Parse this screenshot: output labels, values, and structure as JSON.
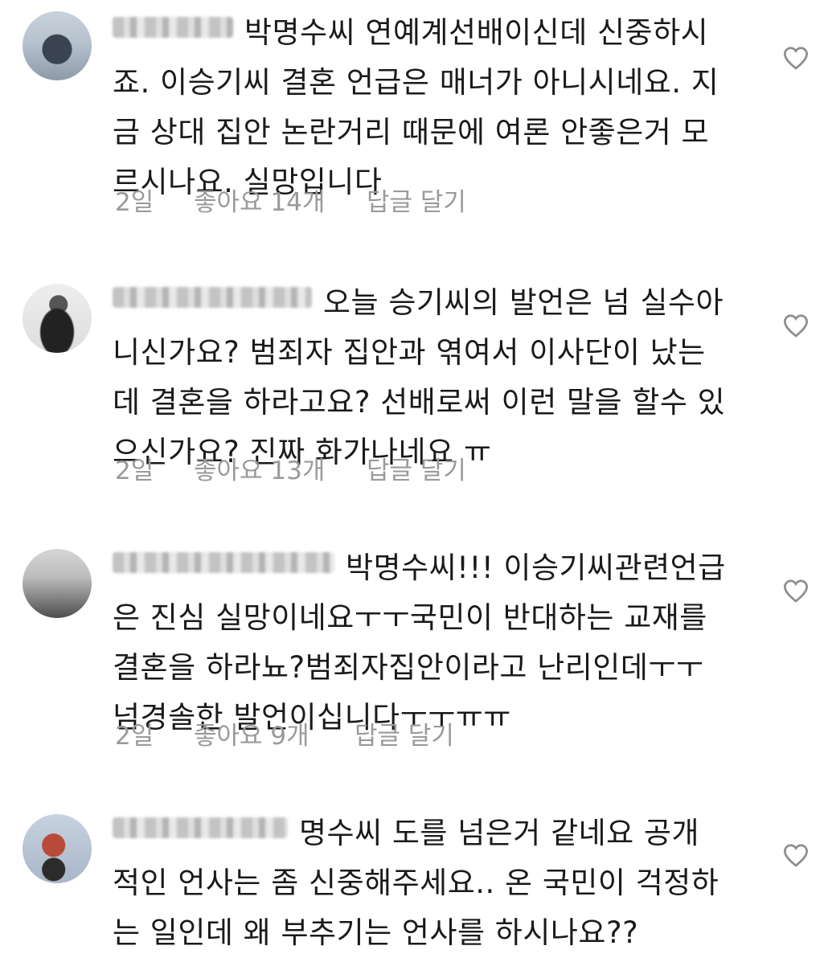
{
  "comments": [
    {
      "text": "박명수씨 연예계선배이신데 신중하시\n죠. 이승기씨 결혼 언급은 매너가 아니시네요. 지\n금 상대 집안 논란거리 때문에 여론 안좋은거 모\n르시나요. 실망입니다",
      "time": "2일",
      "likes": "좋아요 14개",
      "reply": "답글 달기"
    },
    {
      "text": "오늘 승기씨의 발언은 넘 실수아\n니신가요? 범죄자 집안과 엮여서 이사단이 났는\n데 결혼을 하라고요? 선배로써 이런 말을 할수 있\n으신가요? 진짜 화가나네요 ㅠ",
      "time": "2일",
      "likes": "좋아요 13개",
      "reply": "답글 달기"
    },
    {
      "text": "박명수씨!!! 이승기씨관련언급\n은 진심 실망이네요ㅜㅜ국민이 반대하는 교재를\n결혼을 하라뇨?범죄자집안이라고 난리인데ㅜㅜ\n넘경솔한 발언이십니다ㅜㅜㅠㅠ",
      "time": "2일",
      "likes": "좋아요 9개",
      "reply": "답글 달기"
    },
    {
      "text": "명수씨 도를 넘은거 같네요 공개\n적인 언사는 좀 신중해주세요.. 온 국민이 걱정하\n는 일인데 왜 부추기는 언사를 하시나요??",
      "time": "",
      "likes": "",
      "reply": ""
    }
  ],
  "icons": {
    "avatar": "avatar",
    "like": "heart-outline-icon"
  },
  "colors": {
    "text": "#1a1a1a",
    "meta": "#9a9a9a",
    "heart": "#8e8e8e"
  }
}
